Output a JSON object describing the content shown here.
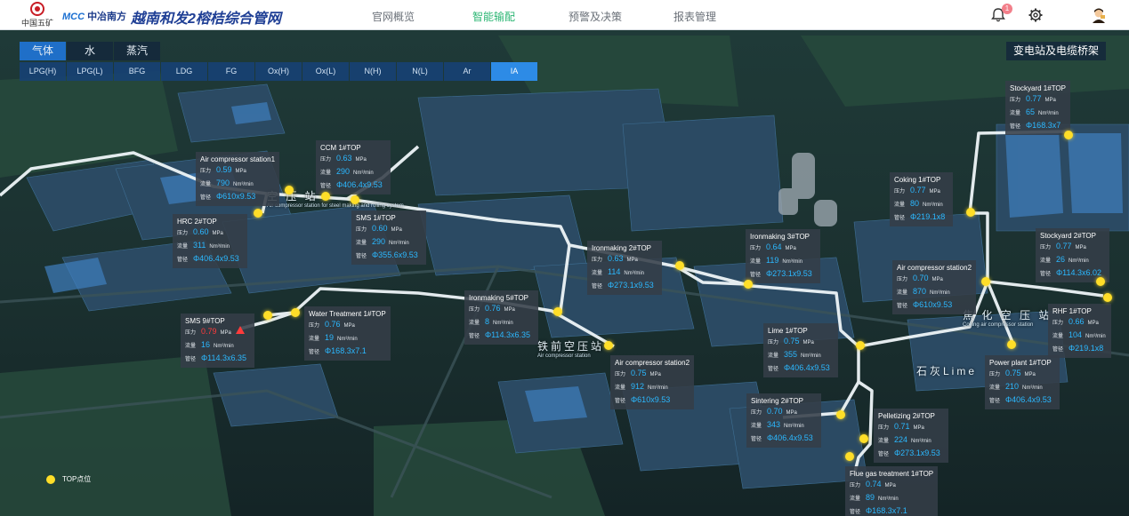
{
  "header": {
    "logo_owner": "中国五矿",
    "logo_mcc": "MCC",
    "logo_company": "中冶南方",
    "title": "越南和发2榕桔综合管网",
    "nav": [
      "官网概览",
      "智能输配",
      "预警及决策",
      "报表管理"
    ],
    "active_nav": "智能输配",
    "notification_count": "1",
    "accent_color": "#2bb673"
  },
  "tabs": [
    "气体",
    "水",
    "蒸汽"
  ],
  "active_tab": "气体",
  "subtabs": [
    "LPG(H)",
    "LPG(L)",
    "BFG",
    "LDG",
    "FG",
    "Ox(H)",
    "Ox(L)",
    "N(H)",
    "N(L)",
    "Ar",
    "IA"
  ],
  "active_subtab": "IA",
  "corner_button": "变电站及电缆桥架",
  "labels": {
    "pressure": "压力",
    "flow": "流量",
    "pipe": "管径",
    "unit_pressure": "MPa",
    "unit_flow": "Nm³/min"
  },
  "areas": {
    "a1": "空  压  站",
    "a1_sub": "Air compressor station for steel making and rolling system",
    "a2": "铁前空压站",
    "a2_sub": "Air compressor station",
    "a3": "焦 化 空 压 站",
    "a3_sub": "Coking air compressor station",
    "a4": "石灰Lime"
  },
  "legend": {
    "label": "TOP点位"
  },
  "stations": [
    {
      "name": "Air compressor station1",
      "pressure": "0.59",
      "flow": "790",
      "pipe": "Φ610x9.53"
    },
    {
      "name": "CCM 1#TOP",
      "pressure": "0.63",
      "flow": "290",
      "pipe": "Φ406.4x9.53"
    },
    {
      "name": "HRC 2#TOP",
      "pressure": "0.60",
      "flow": "311",
      "pipe": "Φ406.4x9.53"
    },
    {
      "name": "SMS 1#TOP",
      "pressure": "0.60",
      "flow": "290",
      "pipe": "Φ355.6x9.53"
    },
    {
      "name": "Ironmaking 2#TOP",
      "pressure": "0.63",
      "flow": "114",
      "pipe": "Φ273.1x9.53"
    },
    {
      "name": "Ironmaking 3#TOP",
      "pressure": "0.64",
      "flow": "119",
      "pipe": "Φ273.1x9.53"
    },
    {
      "name": "Coking 1#TOP",
      "pressure": "0.77",
      "flow": "80",
      "pipe": "Φ219.1x8"
    },
    {
      "name": "Stockyard 1#TOP",
      "pressure": "0.77",
      "flow": "65",
      "pipe": "Φ168.3x7"
    },
    {
      "name": "Stockyard 2#TOP",
      "pressure": "0.77",
      "flow": "26",
      "pipe": "Φ114.3x6.02"
    },
    {
      "name": "Air compressor station2",
      "pressure": "0.70",
      "flow": "870",
      "pipe": "Φ610x9.53"
    },
    {
      "name": "RHF 1#TOP",
      "pressure": "0.66",
      "flow": "104",
      "pipe": "Φ219.1x8"
    },
    {
      "name": "Ironmaking 5#TOP",
      "pressure": "0.76",
      "flow": "8",
      "pipe": "Φ114.3x6.35"
    },
    {
      "name": "Water Treatment 1#TOP",
      "pressure": "0.76",
      "flow": "19",
      "pipe": "Φ168.3x7.1"
    },
    {
      "name": "SMS 9#TOP",
      "pressure": "0.79",
      "flow": "16",
      "pipe": "Φ114.3x6.35",
      "alarm": true
    },
    {
      "name": "Lime 1#TOP",
      "pressure": "0.75",
      "flow": "355",
      "pipe": "Φ406.4x9.53"
    },
    {
      "name": "Power plant 1#TOP",
      "pressure": "0.75",
      "flow": "210",
      "pipe": "Φ406.4x9.53"
    },
    {
      "name": "Air compressor station2",
      "pressure": "0.75",
      "flow": "912",
      "pipe": "Φ610x9.53"
    },
    {
      "name": "Sintering 2#TOP",
      "pressure": "0.70",
      "flow": "343",
      "pipe": "Φ406.4x9.53"
    },
    {
      "name": "Pelletizing 2#TOP",
      "pressure": "0.71",
      "flow": "224",
      "pipe": "Φ273.1x9.53"
    },
    {
      "name": "Flue gas treatment 1#TOP",
      "pressure": "0.74",
      "flow": "89",
      "pipe": "Φ168.3x7.1"
    }
  ]
}
